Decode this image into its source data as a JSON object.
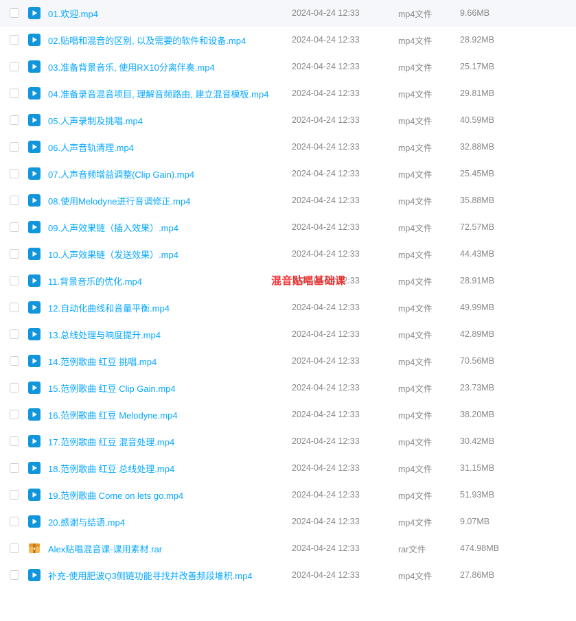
{
  "watermark": "混音贴唱基础课",
  "files": [
    {
      "name": "01.欢迎.mp4",
      "date": "2024-04-24 12:33",
      "type": "mp4文件",
      "size": "9.66MB",
      "icon": "video"
    },
    {
      "name": "02.贴唱和混音的区别, 以及需要的软件和设备.mp4",
      "date": "2024-04-24 12:33",
      "type": "mp4文件",
      "size": "28.92MB",
      "icon": "video"
    },
    {
      "name": "03.准备背景音乐, 使用RX10分离伴奏.mp4",
      "date": "2024-04-24 12:33",
      "type": "mp4文件",
      "size": "25.17MB",
      "icon": "video"
    },
    {
      "name": "04.准备录音混音项目, 理解音频路由, 建立混音模板.mp4",
      "date": "2024-04-24 12:33",
      "type": "mp4文件",
      "size": "29.81MB",
      "icon": "video"
    },
    {
      "name": "05.人声录制及挑唱.mp4",
      "date": "2024-04-24 12:33",
      "type": "mp4文件",
      "size": "40.59MB",
      "icon": "video"
    },
    {
      "name": "06.人声音轨清理.mp4",
      "date": "2024-04-24 12:33",
      "type": "mp4文件",
      "size": "32.88MB",
      "icon": "video"
    },
    {
      "name": "07.人声音频增益调整(Clip Gain).mp4",
      "date": "2024-04-24 12:33",
      "type": "mp4文件",
      "size": "25.45MB",
      "icon": "video"
    },
    {
      "name": "08.使用Melodyne进行音调修正.mp4",
      "date": "2024-04-24 12:33",
      "type": "mp4文件",
      "size": "35.88MB",
      "icon": "video"
    },
    {
      "name": "09.人声效果链（插入效果）.mp4",
      "date": "2024-04-24 12:33",
      "type": "mp4文件",
      "size": "72.57MB",
      "icon": "video"
    },
    {
      "name": "10.人声效果链（发送效果）.mp4",
      "date": "2024-04-24 12:33",
      "type": "mp4文件",
      "size": "44.43MB",
      "icon": "video"
    },
    {
      "name": "11.背景音乐的优化.mp4",
      "date": "2024-04-24 12:33",
      "type": "mp4文件",
      "size": "28.91MB",
      "icon": "video"
    },
    {
      "name": "12.自动化曲线和音量平衡.mp4",
      "date": "2024-04-24 12:33",
      "type": "mp4文件",
      "size": "49.99MB",
      "icon": "video"
    },
    {
      "name": "13.总线处理与响度提升.mp4",
      "date": "2024-04-24 12:33",
      "type": "mp4文件",
      "size": "42.89MB",
      "icon": "video"
    },
    {
      "name": "14.范例歌曲 红豆 挑唱.mp4",
      "date": "2024-04-24 12:33",
      "type": "mp4文件",
      "size": "70.56MB",
      "icon": "video"
    },
    {
      "name": "15.范例歌曲 红豆 Clip Gain.mp4",
      "date": "2024-04-24 12:33",
      "type": "mp4文件",
      "size": "23.73MB",
      "icon": "video"
    },
    {
      "name": "16.范例歌曲 红豆 Melodyne.mp4",
      "date": "2024-04-24 12:33",
      "type": "mp4文件",
      "size": "38.20MB",
      "icon": "video"
    },
    {
      "name": "17.范例歌曲 红豆 混音处理.mp4",
      "date": "2024-04-24 12:33",
      "type": "mp4文件",
      "size": "30.42MB",
      "icon": "video"
    },
    {
      "name": "18.范例歌曲 红豆 总线处理.mp4",
      "date": "2024-04-24 12:33",
      "type": "mp4文件",
      "size": "31.15MB",
      "icon": "video"
    },
    {
      "name": "19.范例歌曲 Come on lets go.mp4",
      "date": "2024-04-24 12:33",
      "type": "mp4文件",
      "size": "51.93MB",
      "icon": "video"
    },
    {
      "name": "20.感谢与结语.mp4",
      "date": "2024-04-24 12:33",
      "type": "mp4文件",
      "size": "9.07MB",
      "icon": "video"
    },
    {
      "name": "Alex贴唱混音课-课用素材.rar",
      "date": "2024-04-24 12:33",
      "type": "rar文件",
      "size": "474.98MB",
      "icon": "rar"
    },
    {
      "name": "补充-使用肥波Q3侧链功能寻找并改善频段堆积.mp4",
      "date": "2024-04-24 12:33",
      "type": "mp4文件",
      "size": "27.86MB",
      "icon": "video"
    }
  ]
}
